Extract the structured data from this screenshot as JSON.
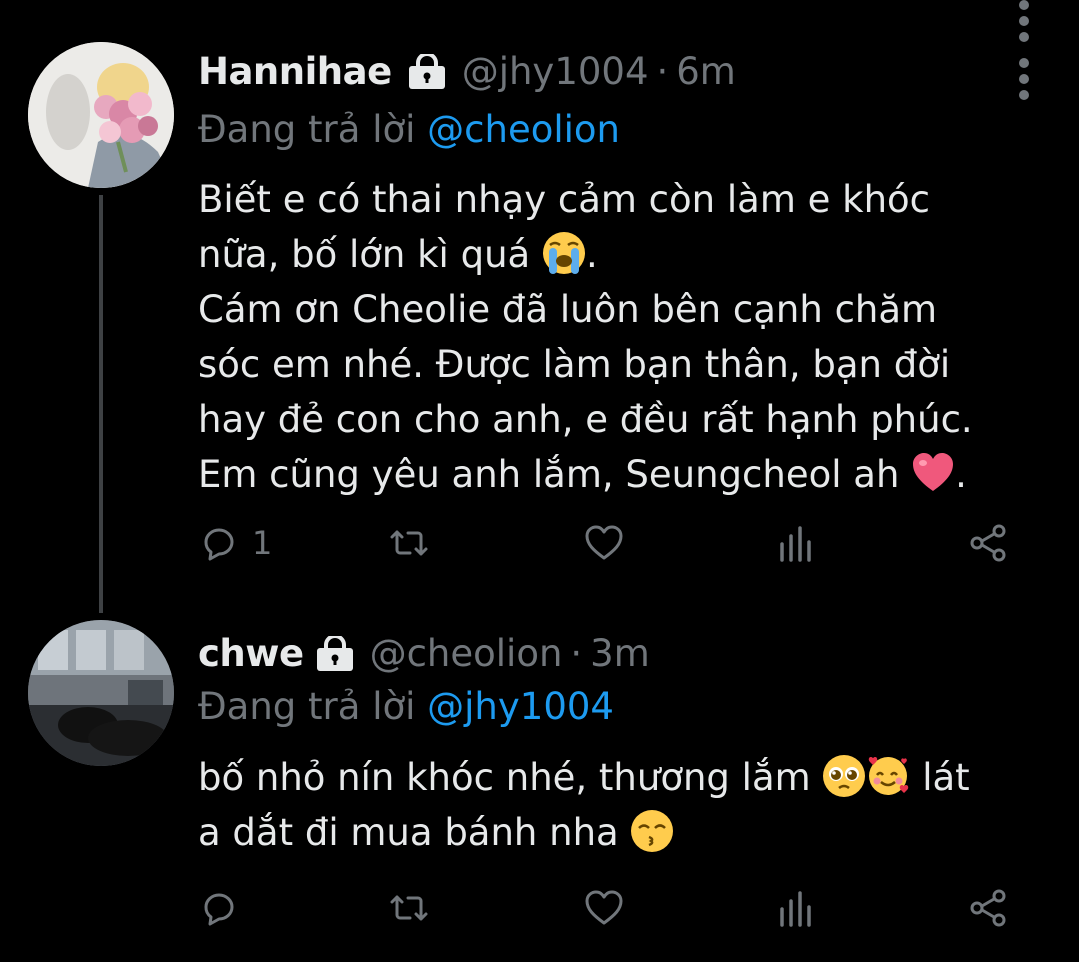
{
  "tweets": [
    {
      "name": "Hannihae",
      "handle": "@jhy1004",
      "dot": "·",
      "time": "6m",
      "replying_prefix": "Đang trả lời ",
      "replying_to": "@cheolion",
      "lines": [
        "Biết e có thai nhạy cảm còn làm e khóc",
        "nữa, bố lớn kì quá ",
        "Cám ơn Cheolie đã luôn bên cạnh chăm",
        "sóc em nhé. Được làm bạn thân, bạn đời",
        "hay đẻ con cho anh, e đều rất hạnh phúc.",
        "Em cũng yêu anh lắm, Seungcheol ah "
      ],
      "period": ".",
      "emojis": [
        "loudly-crying-face",
        "red-heart"
      ],
      "reply_count": "1"
    },
    {
      "name": "chwe",
      "handle": "@cheolion",
      "dot": "·",
      "time": "3m",
      "replying_prefix": "Đang trả lời ",
      "replying_to": "@jhy1004",
      "lines": [
        "bố nhỏ nín khóc nhé, thương lắm ",
        " lát",
        "a dắt đi mua bánh nha "
      ],
      "emojis": [
        "pleading-face",
        "smiling-face-with-hearts",
        "kissing-face-with-smiling-eyes"
      ],
      "reply_count": ""
    }
  ],
  "colors": {
    "background": "#000000",
    "text": "#e7e9ea",
    "secondary": "#71767b",
    "link": "#1d9bf0",
    "thread_line": "#3e4144"
  }
}
